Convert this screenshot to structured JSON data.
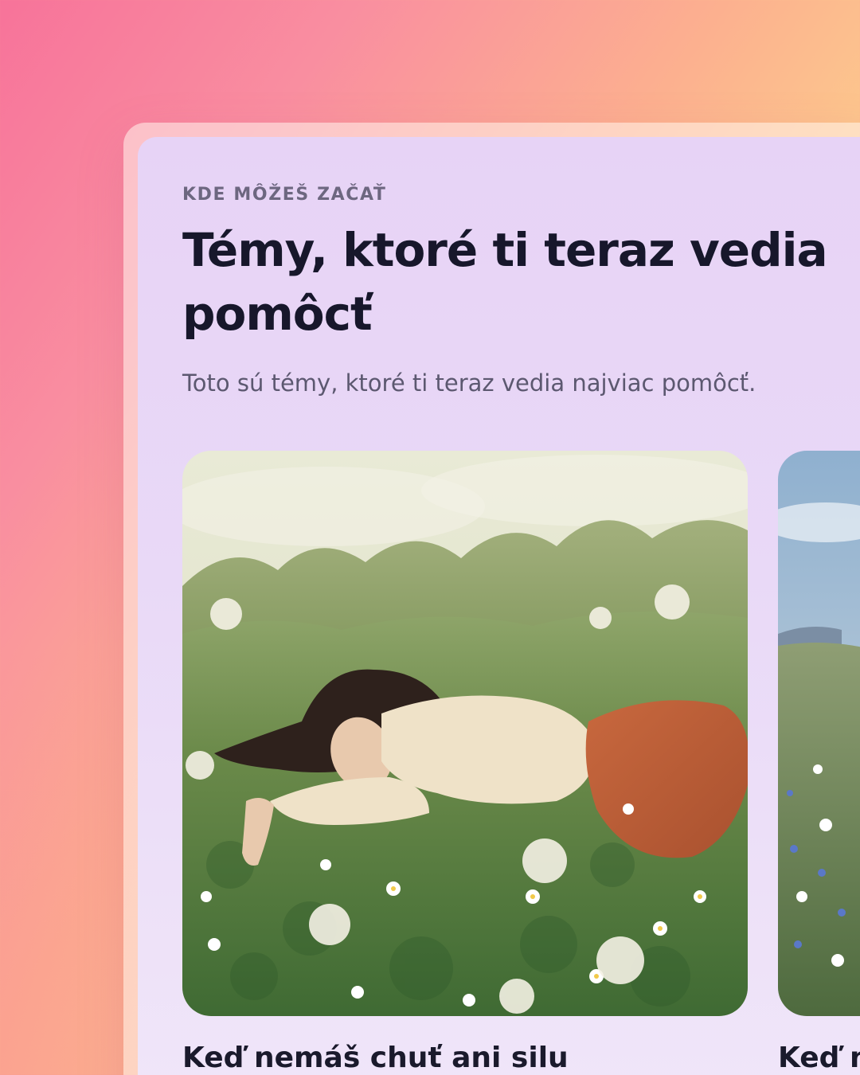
{
  "section": {
    "eyebrow": "KDE MÔŽEŠ ZAČAŤ",
    "title": "Témy, ktoré ti teraz vedia pomôcť",
    "subtitle": "Toto sú témy, ktoré ti teraz vedia najviac pomôcť."
  },
  "cards": [
    {
      "title": "Keď nemáš chuť ani silu",
      "image": "woman-lying-in-meadow-illustration"
    },
    {
      "title": "Keď n",
      "image": "meadow-landscape-illustration"
    }
  ],
  "colors": {
    "panel": "#e9d9f7",
    "title": "#17172b",
    "eyebrow": "#6d6780",
    "subtitle": "#5c5870"
  }
}
